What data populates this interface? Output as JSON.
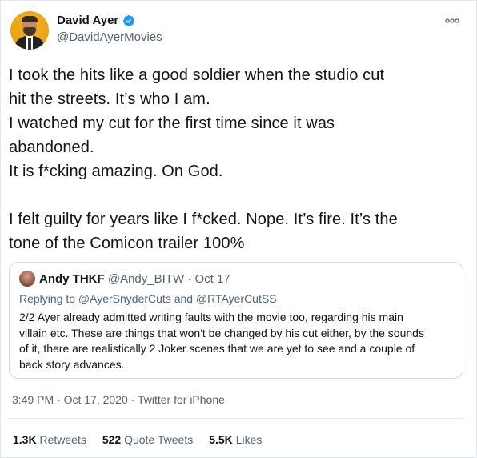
{
  "author": {
    "display_name": "David Ayer",
    "handle": "@DavidAyerMovies",
    "avatar_icon": "profile-photo",
    "verified_icon": "verified-badge-icon"
  },
  "tweet": {
    "lines": [
      "I took the hits like a good soldier when the studio cut",
      "hit the streets. It’s who I am.",
      "I watched my cut for the first time since it was",
      "abandoned.",
      "It is f*cking amazing. On God.",
      "",
      "I felt guilty for years like I f*cked. Nope. It’s fire. It’s the",
      "tone of the Comicon trailer 100%"
    ]
  },
  "quoted_tweet": {
    "display_name": "Andy THKF",
    "handle": "@Andy_BITW",
    "separator": "·",
    "date": "Oct 17",
    "replying_to": "Replying to @AyerSnyderCuts and @RTAyerCutSS",
    "lines": [
      "2/2 Ayer already admitted writing faults with the movie too, regarding his main",
      "villain etc. These are things that won't be changed by his cut either, by the sounds",
      "of it, there are realistically 2 Joker scenes that we are yet to see and a couple of",
      "back story advances."
    ]
  },
  "meta": {
    "time": "3:49 PM",
    "separator": "·",
    "date": "Oct 17, 2020",
    "source": "Twitter for iPhone"
  },
  "stats": [
    {
      "count": "1.3K",
      "label": "Retweets"
    },
    {
      "count": "522",
      "label": "Quote Tweets"
    },
    {
      "count": "5.5K",
      "label": "Likes"
    }
  ],
  "colors": {
    "text": "#0f1419",
    "secondary": "#536471",
    "verified": "#1d9bf0",
    "border": "#cfd9de"
  }
}
